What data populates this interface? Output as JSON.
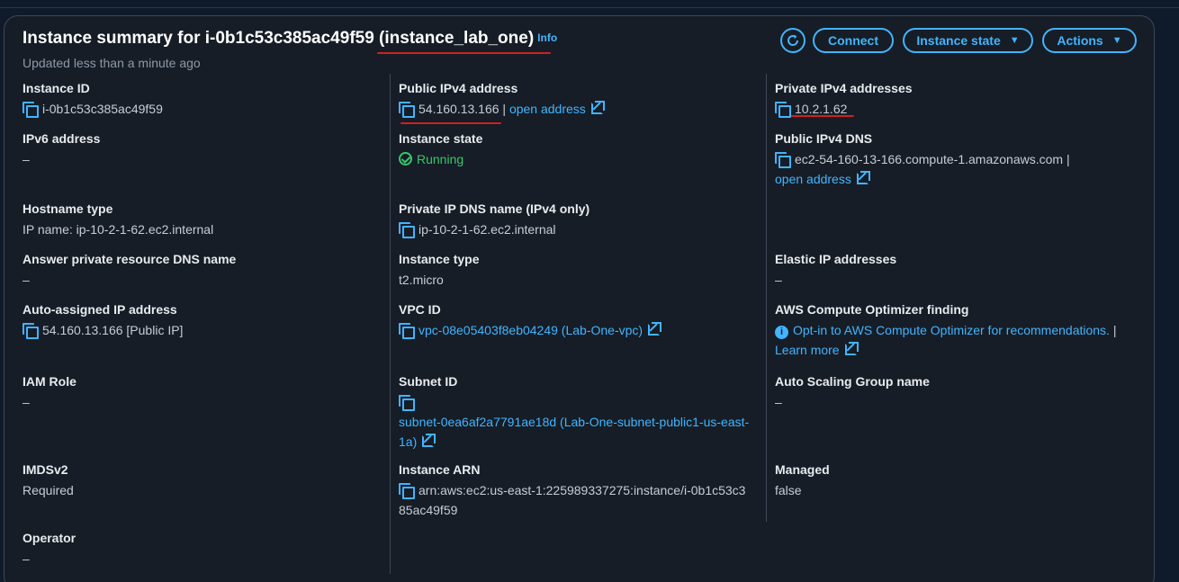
{
  "header": {
    "title": "Instance summary for i-0b1c53c385ac49f59 (instance_lab_one)",
    "info": "Info",
    "updated": "Updated less than a minute ago",
    "connect": "Connect",
    "instance_state": "Instance state",
    "actions": "Actions"
  },
  "col1": {
    "instance_id_label": "Instance ID",
    "instance_id": "i-0b1c53c385ac49f59",
    "ipv6_label": "IPv6 address",
    "ipv6": "–",
    "hostname_type_label": "Hostname type",
    "hostname_type": "IP name: ip-10-2-1-62.ec2.internal",
    "answer_dns_label": "Answer private resource DNS name",
    "answer_dns": "–",
    "auto_ip_label": "Auto-assigned IP address",
    "auto_ip": "54.160.13.166 [Public IP]",
    "iam_label": "IAM Role",
    "iam": "–",
    "imds_label": "IMDSv2",
    "imds": "Required",
    "operator_label": "Operator",
    "operator": "–"
  },
  "col2": {
    "public_ipv4_label": "Public IPv4 address",
    "public_ipv4": "54.160.13.166",
    "open_address": "open address",
    "state_label": "Instance state",
    "state": "Running",
    "private_dns_label": "Private IP DNS name (IPv4 only)",
    "private_dns": "ip-10-2-1-62.ec2.internal",
    "type_label": "Instance type",
    "type": "t2.micro",
    "vpc_label": "VPC ID",
    "vpc": "vpc-08e05403f8eb04249 (Lab-One-vpc)",
    "subnet_label": "Subnet ID",
    "subnet_line1": "subnet-0ea6af2a7791ae18d (Lab-One-subnet-public1-us-east-",
    "subnet_line2": "1a)",
    "arn_label": "Instance ARN",
    "arn_line1": "arn:aws:ec2:us-east-1:225989337275:instance/i-0b1c53c3",
    "arn_line2": "85ac49f59"
  },
  "col3": {
    "private_ipv4_label": "Private IPv4 addresses",
    "private_ipv4": "10.2.1.62",
    "public_dns_label": "Public IPv4 DNS",
    "public_dns": "ec2-54-160-13-166.compute-1.amazonaws.com",
    "open_address": "open address",
    "elastic_label": "Elastic IP addresses",
    "elastic": "–",
    "optimizer_label": "AWS Compute Optimizer finding",
    "optimizer_link": "Opt-in to AWS Compute Optimizer for recommendations.",
    "learn_more": "Learn more",
    "asg_label": "Auto Scaling Group name",
    "asg": "–",
    "managed_label": "Managed",
    "managed": "false"
  },
  "colors": {
    "accent": "#42b4ff",
    "running": "#37c76b",
    "annotation": "#d12020"
  }
}
